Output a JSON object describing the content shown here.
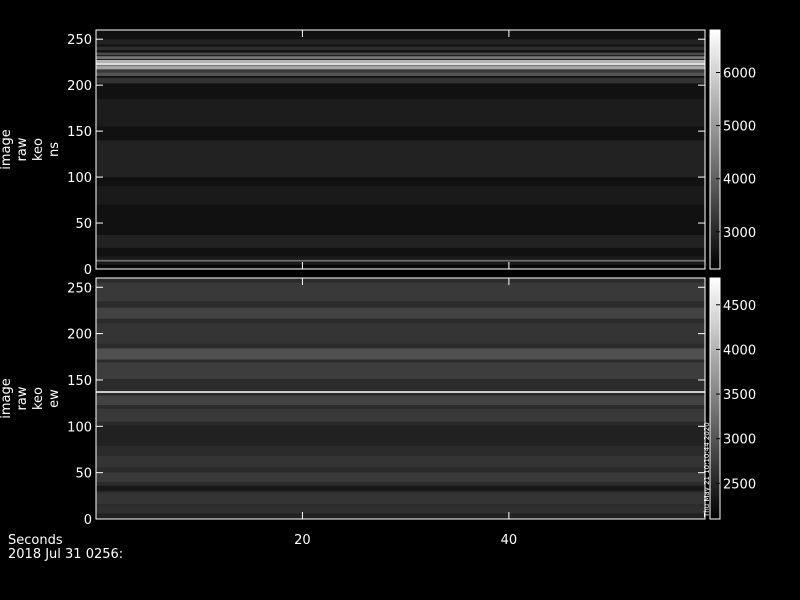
{
  "chart_data": [
    {
      "type": "heatmap",
      "ylabel": [
        "image",
        "raw",
        "keo",
        "ns"
      ],
      "ylim": [
        0,
        260
      ],
      "yticks": [
        0,
        50,
        100,
        150,
        200,
        250
      ],
      "xlim": [
        0,
        59
      ],
      "colorbar": {
        "range": [
          2300,
          6800
        ],
        "ticks": [
          3000,
          4000,
          5000,
          6000
        ]
      },
      "base_intensity": 2600,
      "bands": [
        {
          "y": 3,
          "width": 3,
          "value": 2400
        },
        {
          "y": 6,
          "width": 2,
          "value": 2800
        },
        {
          "y": 9,
          "width": 2,
          "value": 4200
        },
        {
          "y": 12,
          "width": 3,
          "value": 2800
        },
        {
          "y": 30,
          "width": 14,
          "value": 2900
        },
        {
          "y": 80,
          "width": 20,
          "value": 2750
        },
        {
          "y": 120,
          "width": 40,
          "value": 2900
        },
        {
          "y": 170,
          "width": 30,
          "value": 2800
        },
        {
          "y": 205,
          "width": 6,
          "value": 3200
        },
        {
          "y": 212,
          "width": 4,
          "value": 3800
        },
        {
          "y": 215,
          "width": 3,
          "value": 3300
        },
        {
          "y": 219,
          "width": 4,
          "value": 5200
        },
        {
          "y": 223,
          "width": 3,
          "value": 6200
        },
        {
          "y": 226,
          "width": 3,
          "value": 5500
        },
        {
          "y": 230,
          "width": 3,
          "value": 4400
        },
        {
          "y": 234,
          "width": 3,
          "value": 3600
        },
        {
          "y": 240,
          "width": 4,
          "value": 3100
        },
        {
          "y": 247,
          "width": 6,
          "value": 2900
        }
      ]
    },
    {
      "type": "heatmap",
      "ylabel": [
        "image",
        "raw",
        "keo",
        "ew"
      ],
      "ylim": [
        0,
        260
      ],
      "yticks": [
        0,
        50,
        100,
        150,
        200,
        250
      ],
      "xlim": [
        0,
        59
      ],
      "colorbar": {
        "range": [
          2100,
          4800
        ],
        "ticks": [
          2500,
          3000,
          3500,
          4000,
          4500
        ]
      },
      "base_intensity": 2550,
      "bands": [
        {
          "y": 3,
          "width": 6,
          "value": 2450
        },
        {
          "y": 10,
          "width": 8,
          "value": 2600
        },
        {
          "y": 22,
          "width": 12,
          "value": 2650
        },
        {
          "y": 33,
          "width": 6,
          "value": 2350
        },
        {
          "y": 45,
          "width": 10,
          "value": 2700
        },
        {
          "y": 62,
          "width": 12,
          "value": 2650
        },
        {
          "y": 90,
          "width": 22,
          "value": 2450
        },
        {
          "y": 112,
          "width": 14,
          "value": 2700
        },
        {
          "y": 128,
          "width": 10,
          "value": 2800
        },
        {
          "y": 137,
          "width": 2,
          "value": 4400
        },
        {
          "y": 160,
          "width": 18,
          "value": 2750
        },
        {
          "y": 178,
          "width": 12,
          "value": 2950
        },
        {
          "y": 200,
          "width": 22,
          "value": 2650
        },
        {
          "y": 222,
          "width": 12,
          "value": 2800
        },
        {
          "y": 245,
          "width": 20,
          "value": 2700
        }
      ],
      "stamp": "Thu May 21 10:10:44 2020"
    }
  ],
  "bottom_axis": {
    "ticks": [
      20,
      40
    ],
    "label": "Seconds",
    "date": "2018 Jul 31 0256:"
  }
}
